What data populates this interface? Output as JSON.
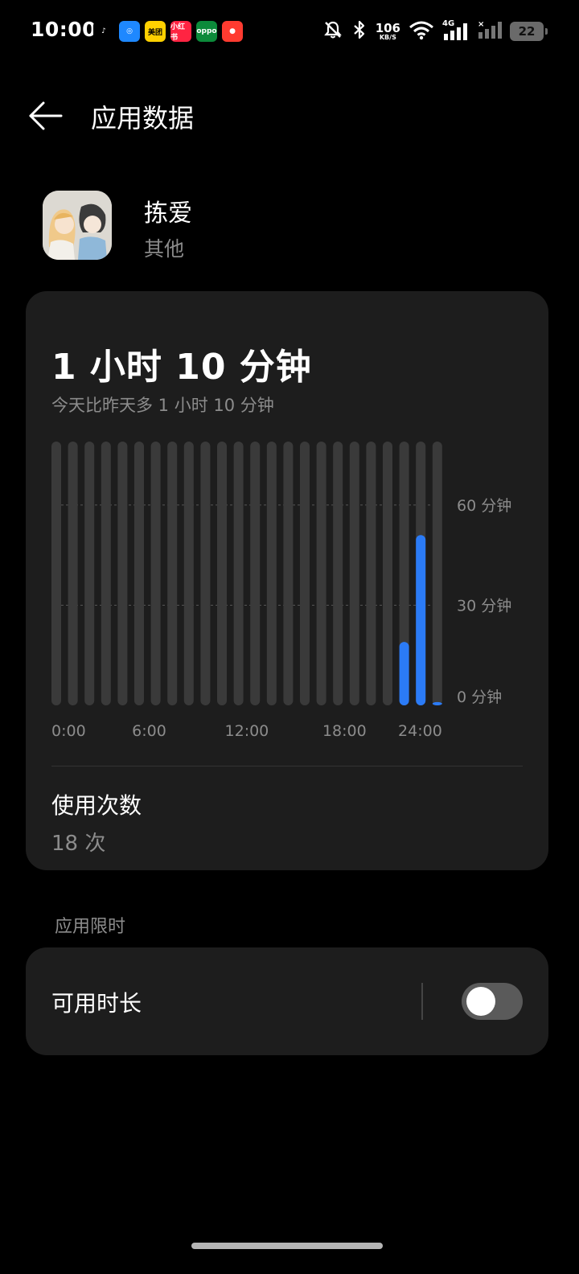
{
  "status_bar": {
    "time": "10:00",
    "net_speed_value": "106",
    "net_speed_unit": "KB/S",
    "network_type": "4G",
    "battery": "22",
    "notification_icons": [
      {
        "name": "douyin-icon",
        "label": "♪",
        "color": "#000000"
      },
      {
        "name": "browser-icon",
        "label": "◎",
        "color": "#1e88ff"
      },
      {
        "name": "meituan-icon",
        "label": "美团",
        "color": "#ffd100"
      },
      {
        "name": "xiaohongshu-icon",
        "label": "小红书",
        "color": "#ff2442"
      },
      {
        "name": "oppo-icon",
        "label": "oppo",
        "color": "#0c8a3a"
      },
      {
        "name": "app-notification-icon",
        "label": "●",
        "color": "#ff3b30"
      }
    ]
  },
  "header": {
    "title": "应用数据"
  },
  "app": {
    "name": "拣爱",
    "category": "其他"
  },
  "usage": {
    "total_time": "1 小时 10 分钟",
    "comparison": "今天比昨天多 1 小时 10 分钟",
    "launch_count_title": "使用次数",
    "launch_count_value": "18 次"
  },
  "chart_data": {
    "type": "bar",
    "categories": [
      "0",
      "1",
      "2",
      "3",
      "4",
      "5",
      "6",
      "7",
      "8",
      "9",
      "10",
      "11",
      "12",
      "13",
      "14",
      "15",
      "16",
      "17",
      "18",
      "19",
      "20",
      "21",
      "22",
      "23"
    ],
    "values": [
      0,
      0,
      0,
      0,
      0,
      0,
      0,
      0,
      0,
      0,
      0,
      0,
      0,
      0,
      0,
      0,
      0,
      0,
      0,
      0,
      0,
      19,
      51,
      1
    ],
    "x_tick_labels": [
      "0:00",
      "6:00",
      "12:00",
      "18:00",
      "24:00"
    ],
    "y_tick_labels": [
      "60 分钟",
      "30 分钟",
      "0 分钟"
    ],
    "y_ticks": [
      60,
      30,
      0
    ],
    "ylim": [
      0,
      79
    ],
    "bar_color": "#2b7bf6",
    "track_color": "#3a3a3a"
  },
  "limit": {
    "section_title": "应用限时",
    "label": "可用时长",
    "enabled": false
  }
}
